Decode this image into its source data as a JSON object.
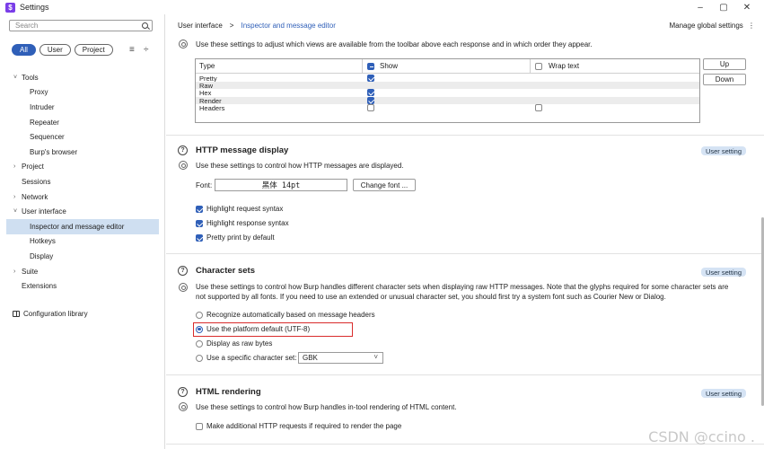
{
  "window": {
    "title": "Settings",
    "app_icon": "$",
    "controls": [
      "–",
      "▢",
      "✕"
    ]
  },
  "sidebar": {
    "search_placeholder": "Search",
    "filters": [
      {
        "label": "All",
        "active": true
      },
      {
        "label": "User"
      },
      {
        "label": "Project"
      }
    ],
    "tree": [
      {
        "label": "Tools",
        "level": 0,
        "chevron": "˅"
      },
      {
        "label": "Proxy",
        "level": 1
      },
      {
        "label": "Intruder",
        "level": 1
      },
      {
        "label": "Repeater",
        "level": 1
      },
      {
        "label": "Sequencer",
        "level": 1
      },
      {
        "label": "Burp's browser",
        "level": 1
      },
      {
        "label": "Project",
        "level": 0,
        "chevron": "›"
      },
      {
        "label": "Sessions",
        "level": 0
      },
      {
        "label": "Network",
        "level": 0,
        "chevron": "›"
      },
      {
        "label": "User interface",
        "level": 0,
        "chevron": "˅"
      },
      {
        "label": "Inspector and message editor",
        "level": 1,
        "selected": true
      },
      {
        "label": "Hotkeys",
        "level": 1
      },
      {
        "label": "Display",
        "level": 1
      },
      {
        "label": "Suite",
        "level": 0,
        "chevron": "›"
      },
      {
        "label": "Extensions",
        "level": 0
      }
    ],
    "configuration_library": "Configuration library"
  },
  "header": {
    "breadcrumb_root": "User interface",
    "breadcrumb_sep": ">",
    "breadcrumb_current": "Inspector and message editor",
    "manage_global": "Manage global settings",
    "manage_menu": "⋮"
  },
  "toolbar_section": {
    "description": "Use these settings to adjust which views are available from the toolbar above each response and in which order they appear.",
    "columns": [
      "Type",
      "Show",
      "Wrap text"
    ],
    "rows": [
      {
        "type": "Pretty",
        "show": true,
        "wrap": null
      },
      {
        "type": "Raw",
        "show": null,
        "wrap": null
      },
      {
        "type": "Hex",
        "show": true,
        "wrap": null
      },
      {
        "type": "Render",
        "show": true,
        "wrap": null
      },
      {
        "type": "Headers",
        "show": false,
        "wrap": false
      }
    ],
    "up_label": "Up",
    "down_label": "Down"
  },
  "http_display": {
    "title": "HTTP message display",
    "badge": "User setting",
    "description": "Use these settings to control how HTTP messages are displayed.",
    "font_label": "Font:",
    "font_value": "黑体  14pt",
    "change_font": "Change font ...",
    "options": [
      {
        "label": "Highlight request syntax",
        "checked": true
      },
      {
        "label": "Highlight response syntax",
        "checked": true
      },
      {
        "label": "Pretty print by default",
        "checked": true
      }
    ]
  },
  "charsets": {
    "title": "Character sets",
    "badge": "User setting",
    "description": "Use these settings to control how Burp handles different character sets when displaying raw HTTP messages. Note that the glyphs required for some character sets are not supported by all fonts. If you need to use an extended or unusual character set, you should first try a system font such as Courier New or Dialog.",
    "options": [
      {
        "label": "Recognize automatically based on message headers",
        "selected": false
      },
      {
        "label": "Use the platform default (UTF-8)",
        "selected": true
      },
      {
        "label": "Display as raw bytes",
        "selected": false
      },
      {
        "label": "Use a specific character set:",
        "selected": false
      }
    ],
    "charset_value": "GBK",
    "charset_chevron": "˅"
  },
  "html_rendering": {
    "title": "HTML rendering",
    "badge": "User setting",
    "description": "Use these settings to control how Burp handles in-tool rendering of HTML content.",
    "option": "Make additional HTTP requests if required to render the page"
  },
  "watermark": "CSDN @ccino ."
}
